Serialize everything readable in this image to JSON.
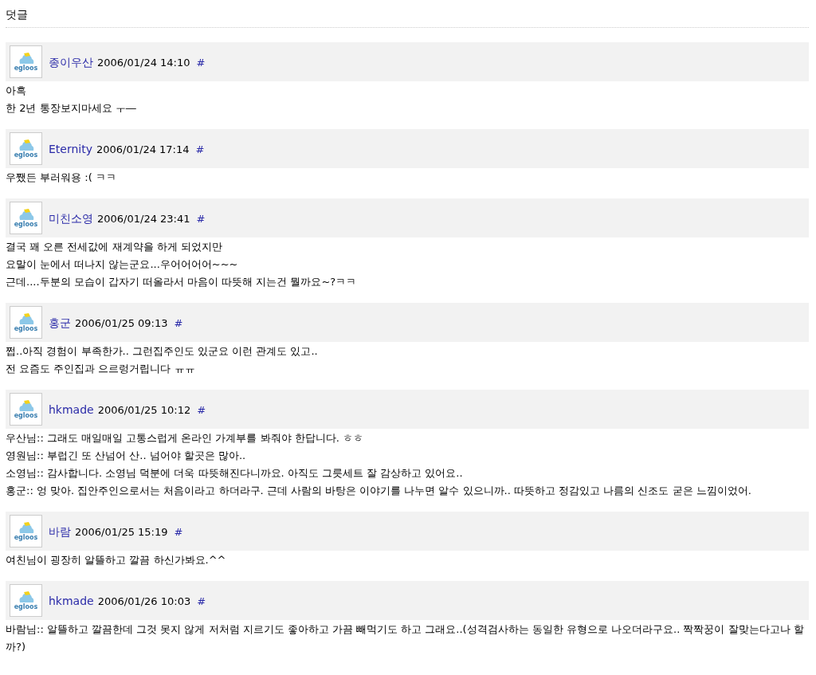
{
  "heading": "덧글",
  "comments": [
    {
      "avatar_label": "egloos",
      "author": "종이우산",
      "date": "2006/01/24 14:10",
      "permalink": "#",
      "lines": [
        "아흑",
        "한 2년 통장보지마세요 ㅜ―"
      ]
    },
    {
      "avatar_label": "egloos",
      "author": "Eternity",
      "date": "2006/01/24 17:14",
      "permalink": "#",
      "lines": [
        "우쨌든 부러워용 :( ㅋㅋ"
      ]
    },
    {
      "avatar_label": "egloos",
      "author": "미친소영",
      "date": "2006/01/24 23:41",
      "permalink": "#",
      "lines": [
        "결국 꽤 오른 전세값에 재계약을 하게 되었지만",
        "요말이 눈에서 떠나지 않는군요...우어어어어~~~",
        "근데....두분의 모습이 갑자기 떠올라서 마음이 따뜻해 지는건 뭘까요~?ㅋㅋ"
      ]
    },
    {
      "avatar_label": "egloos",
      "author": "홍군",
      "date": "2006/01/25 09:13",
      "permalink": "#",
      "lines": [
        "쩝..아직 경험이 부족한가.. 그런집주인도 있군요 이런 관계도 있고..",
        "전 요즘도 주인집과 으르렁거립니다 ㅠㅠ"
      ]
    },
    {
      "avatar_label": "egloos",
      "author": "hkmade",
      "date": "2006/01/25 10:12",
      "permalink": "#",
      "lines": [
        "우산님:: 그래도 매일매일 고통스럽게 온라인 가계부를 봐줘야 한답니다. ㅎㅎ",
        "영원님:: 부럽긴 또 산넘어 산.. 넘어야 할곳은 많아..",
        "소영님:: 감사합니다. 소영님 덕분에 더욱 따뜻해진다니까요. 아직도 그릇세트 잘 감상하고 있어요..",
        "홍군:: 엉 맞아. 집안주인으로서는 처음이라고 하더라구. 근데 사람의 바탕은 이야기를 나누면 알수 있으니까.. 따뜻하고 정감있고 나름의 신조도 굳은 느낌이었어."
      ]
    },
    {
      "avatar_label": "egloos",
      "author": "바람",
      "date": "2006/01/25 15:19",
      "permalink": "#",
      "lines": [
        "여친님이 굉장히 알뜰하고 깔끔 하신가봐요.^^"
      ]
    },
    {
      "avatar_label": "egloos",
      "author": "hkmade",
      "date": "2006/01/26 10:03",
      "permalink": "#",
      "lines": [
        "바람님:: 알뜰하고 깔끔한데 그것 못지 않게 저처럼 지르기도 좋아하고 가끔 빼먹기도 하고 그래요..(성격검사하는 동일한 유형으로 나오더라구요.. 짝짝꿍이 잘맞는다고나 할까?)"
      ]
    }
  ]
}
